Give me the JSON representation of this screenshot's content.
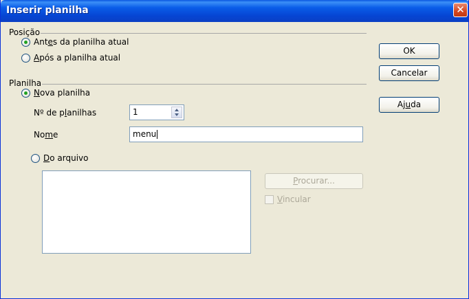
{
  "window": {
    "title": "Inserir planilha",
    "close_icon": "close-icon"
  },
  "position_group": {
    "label": "Posição",
    "option_before": {
      "pre": "Ant",
      "u": "e",
      "post": "s da planilha atual",
      "selected": true
    },
    "option_after": {
      "pre": "",
      "u": "A",
      "post": "pós a planilha atual",
      "selected": false
    }
  },
  "sheet_group": {
    "label": "Planilha",
    "option_new": {
      "pre": "",
      "u": "N",
      "post": "ova planilha",
      "selected": true
    },
    "count_label": {
      "pre": "Nº de p",
      "u": "l",
      "post": "anilhas"
    },
    "count_value": "1",
    "name_label": {
      "pre": "No",
      "u": "m",
      "post": "e"
    },
    "name_value": "menu",
    "option_file": {
      "pre": "",
      "u": "D",
      "post": "o arquivo",
      "selected": false
    },
    "browse_button": {
      "pre": "",
      "u": "P",
      "post": "rocurar..."
    },
    "link_checkbox": {
      "pre": "",
      "u": "V",
      "post": "incular",
      "checked": false
    }
  },
  "buttons": {
    "ok": "OK",
    "cancel": "Cancelar",
    "help": {
      "pre": "Aj",
      "u": "u",
      "post": "da"
    }
  }
}
